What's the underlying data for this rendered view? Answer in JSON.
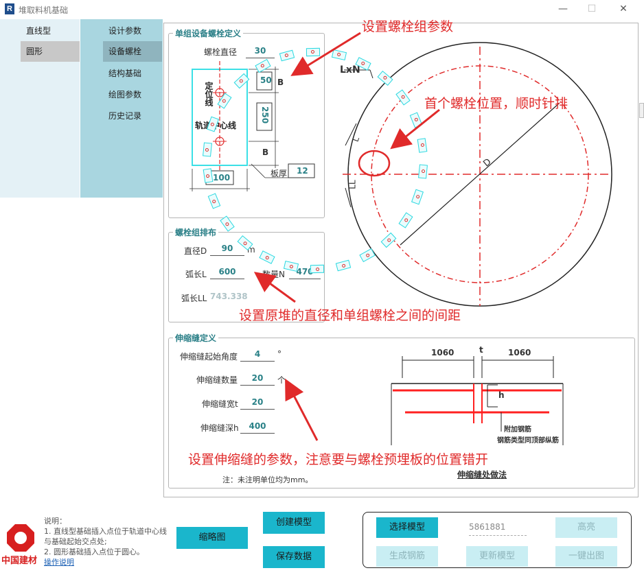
{
  "window": {
    "title": "堆取料机基础",
    "app_icon": "R",
    "minimize": "—",
    "maximize": "☐",
    "close": "✕"
  },
  "nav": {
    "items": [
      {
        "label": "直线型"
      },
      {
        "label": "圆形"
      }
    ]
  },
  "subnav": {
    "items": [
      {
        "label": "设计参数"
      },
      {
        "label": "设备螺栓"
      },
      {
        "label": "结构基础"
      },
      {
        "label": "绘图参数"
      },
      {
        "label": "历史记录"
      }
    ]
  },
  "bolt_def": {
    "title": "单组设备螺栓定义",
    "diameter_label": "螺栓直径",
    "diameter_value": "30",
    "dim_50": "50",
    "dim_250": "250",
    "dim_B_top": "B",
    "dim_B_bot": "B",
    "locator_label": "定位线",
    "track_label": "轨道中心线",
    "plate_label": "板厚",
    "plate_value": "12",
    "width_value": "100"
  },
  "bolt_layout": {
    "title": "螺栓组排布",
    "diameter_label": "直径D",
    "diameter_value": "90",
    "diameter_unit": "m",
    "arc_label": "弧长L",
    "arc_value": "600",
    "count_label": "数量N",
    "count_value": "470",
    "arc_ll_label": "弧长LL",
    "arc_ll_value": "743.338"
  },
  "joint": {
    "title": "伸缩缝定义",
    "angle_label": "伸缩缝起始角度",
    "angle_value": "4",
    "angle_unit": "°",
    "count_label": "伸缩缝数量",
    "count_value": "20",
    "count_unit": "个",
    "width_label": "伸缩缝宽t",
    "width_value": "20",
    "depth_label": "伸缩缝深h",
    "depth_value": "400",
    "note": "注：未注明单位均为mm。"
  },
  "diagram": {
    "circle_label": "LxN",
    "diameter_label": "D",
    "arc_L": "L",
    "arc_LL": "LL",
    "joint_dim_left": "1060",
    "joint_dim_right": "1060",
    "joint_t": "t",
    "joint_h": "h",
    "rebar_note1": "附加钢筋",
    "rebar_note2": "钢筋类型同顶部纵筋",
    "joint_caption": "伸缩缝处做法"
  },
  "annotations": {
    "a1": "设置螺栓组参数",
    "a2": "首个螺栓位置，顺时针排",
    "a3": "设置原堆的直径和单组螺栓之间的间距",
    "a4": "设置伸缩缝的参数，注意要与螺栓预埋板的位置错开"
  },
  "bottom": {
    "logo_text": "中国建材",
    "info_title": "说明：",
    "info_line1": "1. 直线型基础插入点位于轨道中心线与基础起始交点处;",
    "info_line2": "2. 圆形基础插入点位于圆心。",
    "info_link": "操作说明",
    "thumb_btn": "缩略图",
    "create_btn": "创建模型",
    "save_btn": "保存数据",
    "select_btn": "选择模型",
    "model_id": "5861881",
    "highlight_btn": "高亮",
    "gen_rebar_btn": "生成钢筋",
    "update_btn": "更新模型",
    "export_btn": "一键出图"
  },
  "colors": {
    "accent": "#1ab6cc",
    "annotation": "#e02a2a",
    "nav_bg": "#e4f1f6",
    "subnav_bg": "#a9d6e0"
  }
}
